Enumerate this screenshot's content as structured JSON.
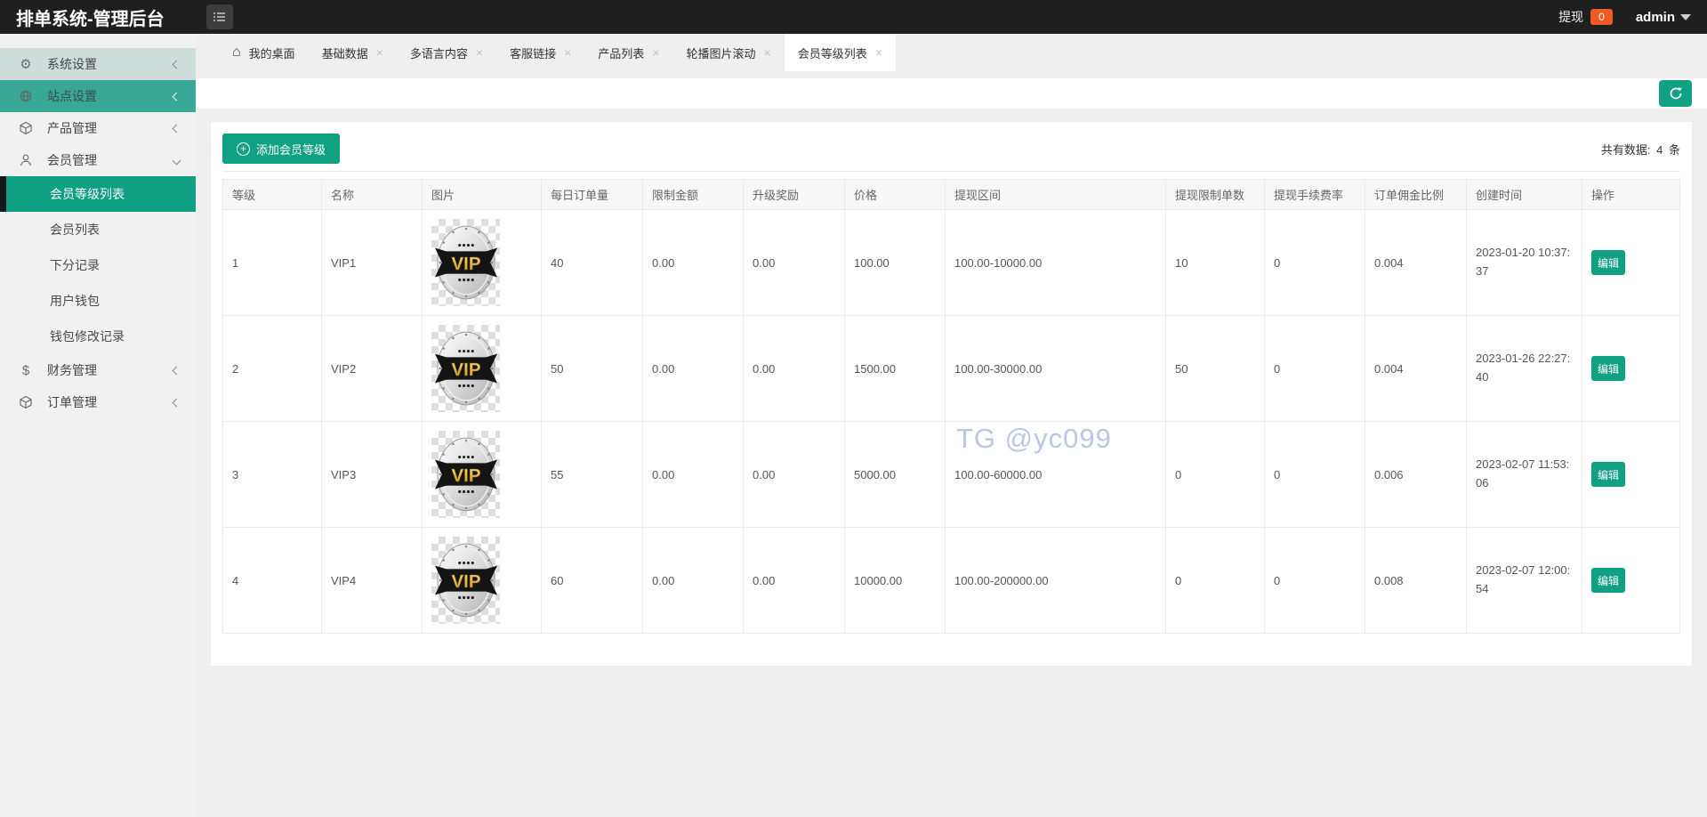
{
  "topbar": {
    "title": "排单系统-管理后台",
    "withdraw_label": "提现",
    "withdraw_count": "0",
    "user": "admin"
  },
  "sidebar": {
    "items": [
      {
        "label": "系统设置",
        "icon": "gear",
        "chevron": "left"
      },
      {
        "label": "站点设置",
        "icon": "globe",
        "chevron": "left"
      },
      {
        "label": "产品管理",
        "icon": "cube",
        "chevron": "left"
      },
      {
        "label": "会员管理",
        "icon": "user",
        "chevron": "down",
        "children": [
          {
            "label": "会员等级列表",
            "active": true
          },
          {
            "label": "会员列表"
          },
          {
            "label": "下分记录"
          },
          {
            "label": "用户钱包"
          },
          {
            "label": "钱包修改记录"
          }
        ]
      },
      {
        "label": "财务管理",
        "icon": "dollar",
        "chevron": "left"
      },
      {
        "label": "订单管理",
        "icon": "cube",
        "chevron": "left"
      }
    ]
  },
  "tabs": [
    {
      "label": "我的桌面",
      "icon": "home",
      "closable": false
    },
    {
      "label": "基础数据",
      "closable": true
    },
    {
      "label": "多语言内容",
      "closable": true
    },
    {
      "label": "客服链接",
      "closable": true
    },
    {
      "label": "产品列表",
      "closable": true
    },
    {
      "label": "轮播图片滚动",
      "closable": true
    },
    {
      "label": "会员等级列表",
      "closable": true,
      "active": true
    }
  ],
  "toolbar": {
    "refresh_icon": "refresh-icon"
  },
  "content": {
    "add_button": "添加会员等级",
    "total_label": "共有数据:",
    "total_count": "4",
    "total_unit": "条",
    "watermark": "TG @yc099",
    "table": {
      "headers": [
        "等级",
        "名称",
        "图片",
        "每日订单量",
        "限制金额",
        "升级奖励",
        "价格",
        "提现区间",
        "提现限制单数",
        "提现手续费率",
        "订单佣金比例",
        "创建时间",
        "操作"
      ],
      "edit_label": "编辑",
      "rows": [
        {
          "level": "1",
          "name": "VIP1",
          "image": "vip-badge",
          "daily_orders": "40",
          "limit_amount": "0.00",
          "upgrade_reward": "0.00",
          "price": "100.00",
          "withdraw_range": "100.00-10000.00",
          "withdraw_limit_count": "10",
          "withdraw_fee_rate": "0",
          "order_commission_rate": "0.004",
          "created_at": "2023-01-20 10:37:37"
        },
        {
          "level": "2",
          "name": "VIP2",
          "image": "vip-badge",
          "daily_orders": "50",
          "limit_amount": "0.00",
          "upgrade_reward": "0.00",
          "price": "1500.00",
          "withdraw_range": "100.00-30000.00",
          "withdraw_limit_count": "50",
          "withdraw_fee_rate": "0",
          "order_commission_rate": "0.004",
          "created_at": "2023-01-26 22:27:40"
        },
        {
          "level": "3",
          "name": "VIP3",
          "image": "vip-badge",
          "daily_orders": "55",
          "limit_amount": "0.00",
          "upgrade_reward": "0.00",
          "price": "5000.00",
          "withdraw_range": "100.00-60000.00",
          "withdraw_limit_count": "0",
          "withdraw_fee_rate": "0",
          "order_commission_rate": "0.006",
          "created_at": "2023-02-07 11:53:06"
        },
        {
          "level": "4",
          "name": "VIP4",
          "image": "vip-badge",
          "daily_orders": "60",
          "limit_amount": "0.00",
          "upgrade_reward": "0.00",
          "price": "10000.00",
          "withdraw_range": "100.00-200000.00",
          "withdraw_limit_count": "0",
          "withdraw_fee_rate": "0",
          "order_commission_rate": "0.008",
          "created_at": "2023-02-07 12:00:54"
        }
      ]
    }
  },
  "colors": {
    "accent_teal": "#10a183",
    "sidebar_parent_teal": "#38a795",
    "sidebar_tint": "#cfdeda",
    "badge_orange": "#f05a23",
    "topbar_bg": "#1f1f1f",
    "watermark_blue": "#b7c3e3"
  }
}
